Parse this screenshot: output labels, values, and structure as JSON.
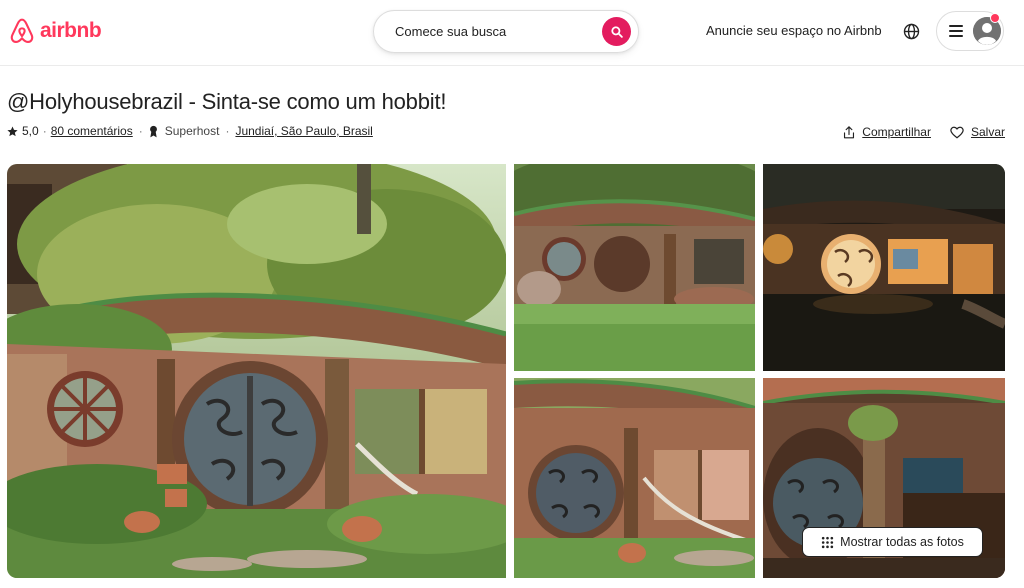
{
  "header": {
    "logo_text": "airbnb",
    "search_label": "Comece sua busca",
    "host_link": "Anuncie seu espaço no Airbnb",
    "brand_color": "#ff385c",
    "search_button_color": "#e31c5f"
  },
  "listing": {
    "title": "@Holyhousebrazil - Sinta-se como um hobbit!",
    "rating": "5,0",
    "rating_sep": "·",
    "reviews": "80 comentários",
    "badge": "Superhost",
    "location": "Jundiaí, São Paulo, Brasil",
    "share_label": "Compartilhar",
    "save_label": "Salvar"
  },
  "gallery": {
    "show_all_label": "Mostrar todas as fotos",
    "photos": [
      {
        "description_icon": "hobbit-house-day-photo"
      },
      {
        "description_icon": "hobbit-house-garden-photo"
      },
      {
        "description_icon": "hobbit-house-night-photo"
      },
      {
        "description_icon": "hobbit-house-door-photo"
      },
      {
        "description_icon": "hobbit-house-interior-photo"
      }
    ]
  },
  "icons": [
    "airbnb-logo-icon",
    "search-icon",
    "globe-icon",
    "hamburger-icon",
    "avatar-icon",
    "star-icon",
    "superhost-icon",
    "share-icon",
    "heart-icon",
    "grid-icon"
  ]
}
